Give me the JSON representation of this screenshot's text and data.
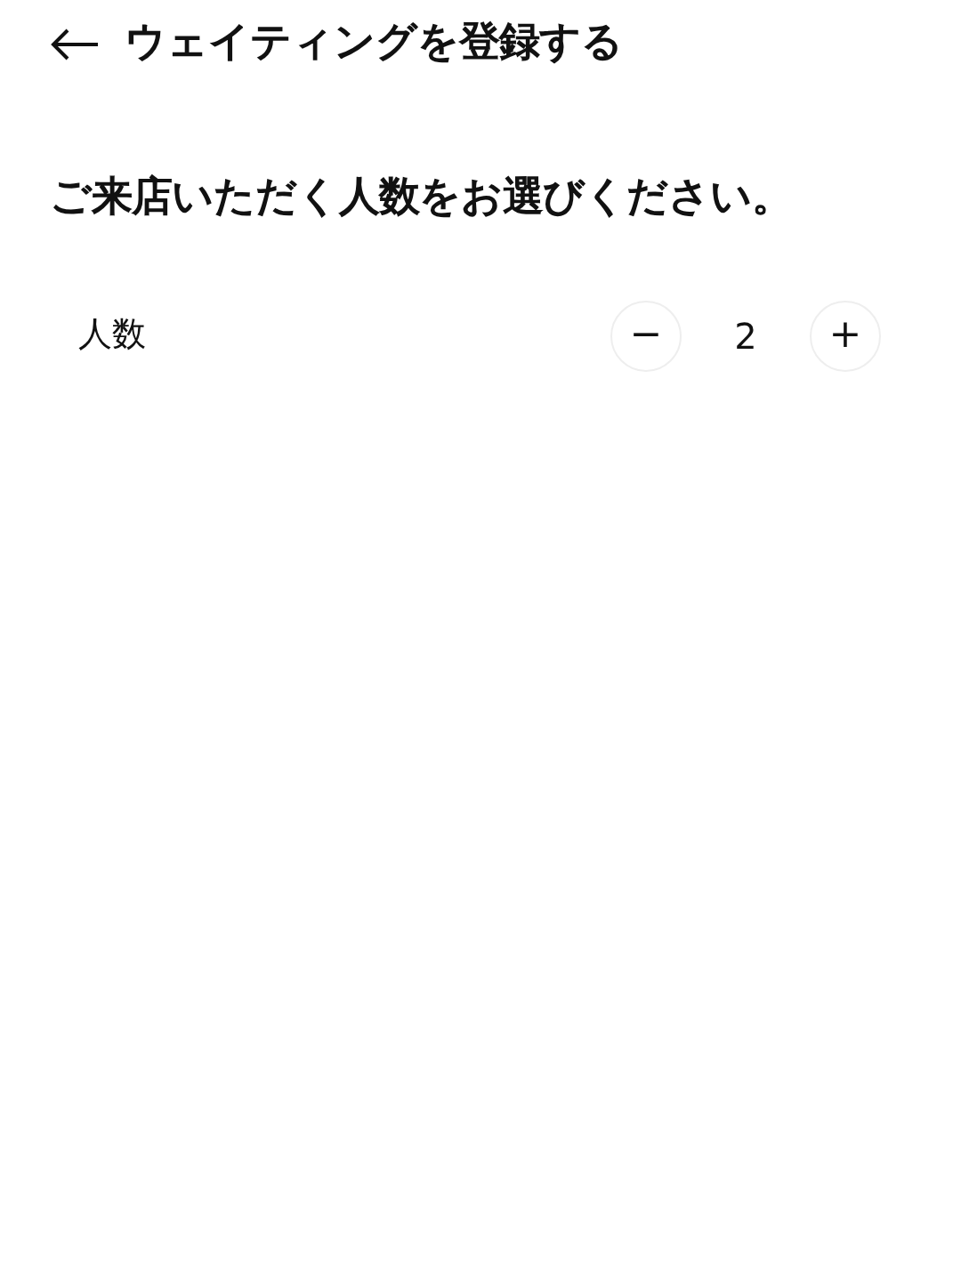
{
  "header": {
    "title": "ウェイティングを登録する"
  },
  "question": "ご来店いただく人数をお選びください。",
  "party_size": {
    "label": "人数",
    "decrement": "−",
    "value": "2",
    "increment": "+"
  }
}
